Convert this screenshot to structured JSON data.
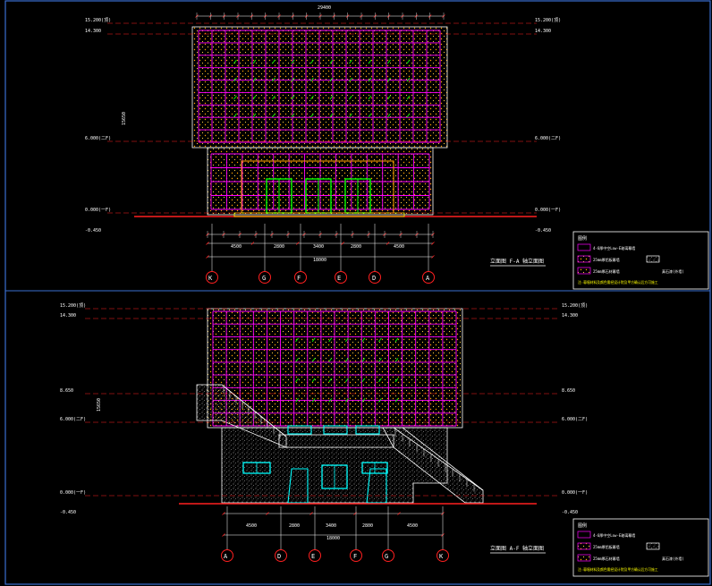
{
  "colors": {
    "background": "#000000",
    "frame": "#3a6fd0",
    "magenta": "#ff00ff",
    "red": "#ff2020",
    "white": "#ffffff",
    "green": "#00ff00",
    "yellow": "#ffff00",
    "cyan": "#00ffff",
    "orange": "#ffa000"
  },
  "front": {
    "title": "立面图 F-A 轴立面图",
    "top_dim": "29400",
    "span_dims": [
      "4500",
      "2800",
      "3400",
      "2800",
      "4500"
    ],
    "overall_dim": "18000",
    "axes": [
      "K",
      "G",
      "F",
      "E",
      "D",
      "A"
    ],
    "levels_left": [
      "15.200(顶)",
      "14.300",
      "6.000(二F)",
      "0.000(一F)",
      "-0.450"
    ],
    "levels_right": [
      "15.200(顶)",
      "14.300",
      "6.000(二F)",
      "0.000(一F)",
      "-0.450"
    ],
    "total_height": "15650"
  },
  "side": {
    "title": "立面图 A-F 轴立面图",
    "span_dims": [
      "4500",
      "2800",
      "3400",
      "2800",
      "4500"
    ],
    "overall_dim": "18000",
    "axes": [
      "A",
      "D",
      "E",
      "F",
      "G",
      "K"
    ],
    "levels_left": [
      "15.200(顶)",
      "14.300",
      "8.650",
      "6.000(二F)",
      "0.000(一F)",
      "-0.450"
    ],
    "levels_right": [
      "15.200(顶)",
      "14.300",
      "8.650",
      "6.000(二F)",
      "0.000(一F)",
      "-0.450"
    ],
    "total_height": "15650"
  },
  "legend": {
    "title": "图例",
    "items": [
      "4-6厚中空Low-E玻璃幕墙",
      "25mm厚铝板幕墙",
      "25mm厚石材幕墙",
      "真石漆(外墙)"
    ],
    "note": "注:幕墙材料及颜色需经设计院及甲方确认后方可施工"
  }
}
